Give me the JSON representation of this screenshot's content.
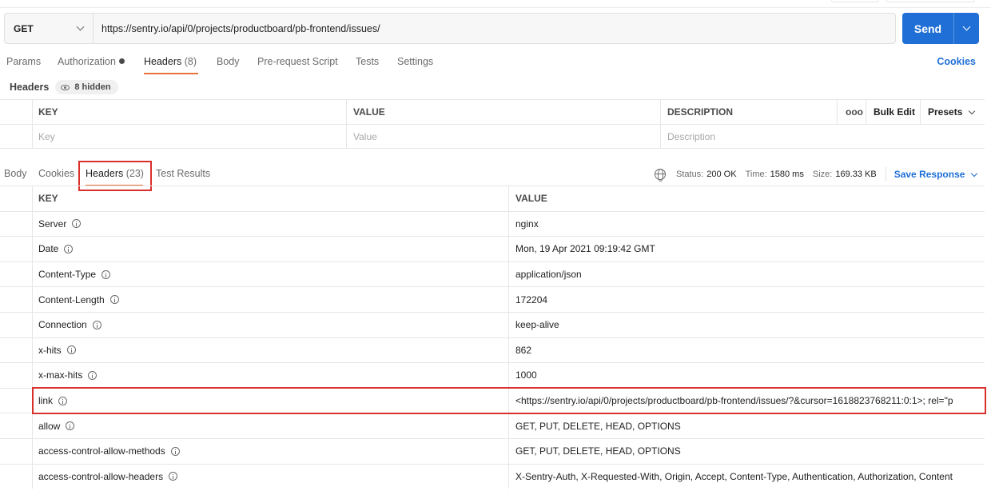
{
  "request": {
    "method": "GET",
    "url": "https://sentry.io/api/0/projects/productboard/pb-frontend/issues/",
    "send_label": "Send"
  },
  "request_tabs": {
    "params": "Params",
    "authorization": "Authorization",
    "headers": "Headers",
    "headers_count": "(8)",
    "body": "Body",
    "pre_request": "Pre-request Script",
    "tests": "Tests",
    "settings": "Settings",
    "cookies": "Cookies"
  },
  "request_headers": {
    "title": "Headers",
    "hidden": "8 hidden",
    "columns": {
      "key": "KEY",
      "value": "VALUE",
      "description": "DESCRIPTION"
    },
    "more": "ooo",
    "bulk_edit": "Bulk Edit",
    "presets": "Presets",
    "placeholders": {
      "key": "Key",
      "value": "Value",
      "description": "Description"
    }
  },
  "response_tabs": {
    "body": "Body",
    "cookies": "Cookies",
    "headers": "Headers",
    "headers_count": "(23)",
    "test_results": "Test Results"
  },
  "response_status": {
    "status_label": "Status:",
    "status": "200 OK",
    "time_label": "Time:",
    "time": "1580 ms",
    "size_label": "Size:",
    "size": "169.33 KB",
    "save_response": "Save Response"
  },
  "response_headers": {
    "columns": {
      "key": "KEY",
      "value": "VALUE"
    },
    "rows": [
      {
        "key": "Server",
        "value": "nginx"
      },
      {
        "key": "Date",
        "value": "Mon, 19 Apr 2021 09:19:42 GMT"
      },
      {
        "key": "Content-Type",
        "value": "application/json"
      },
      {
        "key": "Content-Length",
        "value": "172204"
      },
      {
        "key": "Connection",
        "value": "keep-alive"
      },
      {
        "key": "x-hits",
        "value": "862"
      },
      {
        "key": "x-max-hits",
        "value": "1000"
      },
      {
        "key": "link",
        "value": "<https://sentry.io/api/0/projects/productboard/pb-frontend/issues/?&cursor=1618823768211:0:1>; rel=\"p"
      },
      {
        "key": "allow",
        "value": "GET, PUT, DELETE, HEAD, OPTIONS"
      },
      {
        "key": "access-control-allow-methods",
        "value": "GET, PUT, DELETE, HEAD, OPTIONS"
      },
      {
        "key": "access-control-allow-headers",
        "value": "X-Sentry-Auth, X-Requested-With, Origin, Accept, Content-Type, Authentication, Authorization, Content"
      }
    ]
  },
  "colors": {
    "accent_blue": "#1f6fd6",
    "active_tab_underline": "#e8723a",
    "highlight_red": "#d9302c"
  }
}
